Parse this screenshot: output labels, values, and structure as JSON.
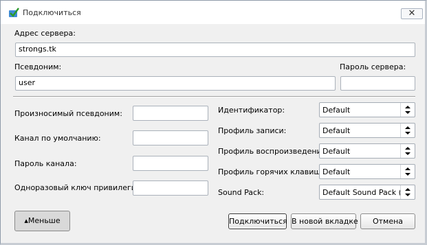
{
  "window": {
    "title": "Подключиться",
    "close_glyph": "✕"
  },
  "fields": {
    "server_address": {
      "label": "Адрес сервера:",
      "value": "strongs.tk"
    },
    "nickname": {
      "label": "Псевдоним:",
      "value": "user"
    },
    "server_password": {
      "label": "Пароль сервера:",
      "value": ""
    },
    "spoken_nickname": {
      "label": "Произносимый псевдоним:",
      "value": ""
    },
    "default_channel": {
      "label": "Канал по умолчанию:",
      "value": ""
    },
    "channel_password": {
      "label": "Пароль канала:",
      "value": ""
    },
    "privilege_key": {
      "label": "Одноразовый ключ привилегий:",
      "value": ""
    }
  },
  "combos": {
    "identity": {
      "label": "Идентификатор:",
      "value": "Default"
    },
    "capture_profile": {
      "label": "Профиль записи:",
      "value": "Default"
    },
    "playback_profile": {
      "label": "Профиль воспроизведения:",
      "value": "Default"
    },
    "hotkey_profile": {
      "label": "Профиль горячих клавиш:",
      "value": "Default"
    },
    "sound_pack": {
      "label": "Sound Pack:",
      "value": "Default Sound Pack (Fer"
    }
  },
  "buttons": {
    "less": "▴Меньше",
    "connect": "Подключиться",
    "new_tab": "В новой вкладке",
    "cancel": "Отмена"
  },
  "icons": {
    "title": "teamspeak-connect-icon",
    "combo_arrow": "updown-arrows-icon"
  }
}
